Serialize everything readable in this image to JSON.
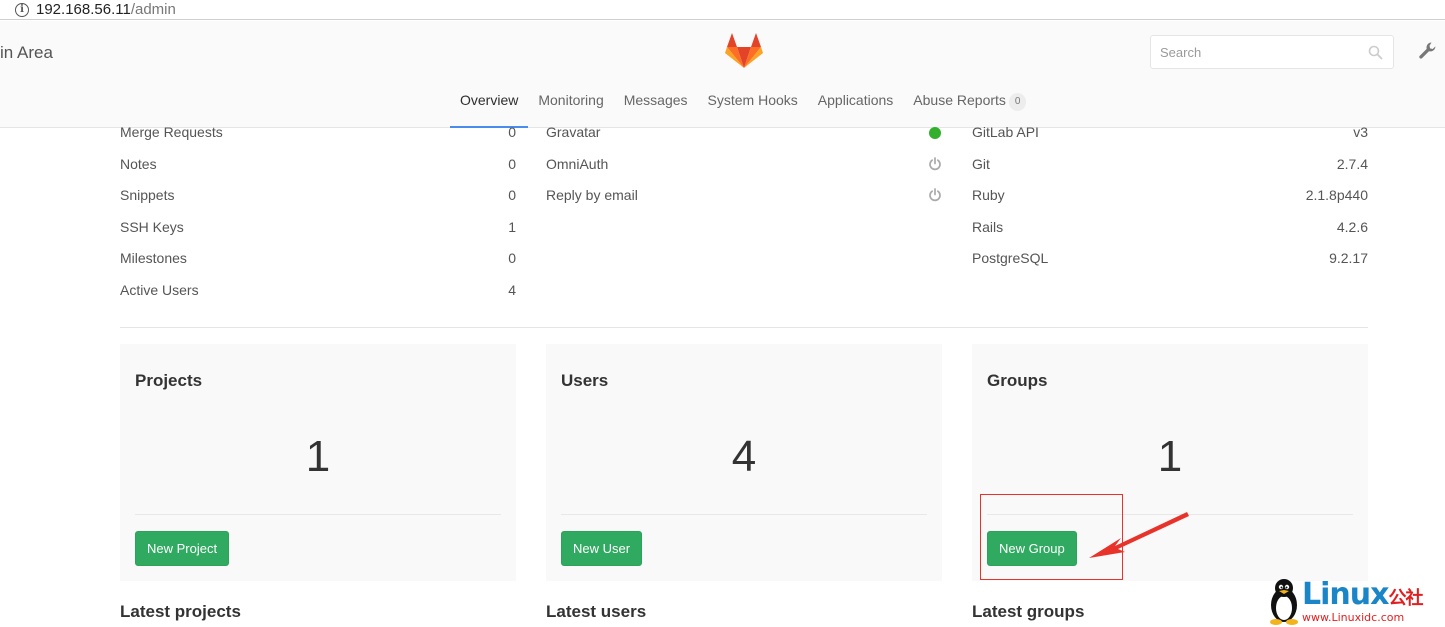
{
  "browser": {
    "url_host": "192.168.56.11",
    "url_path": "/admin"
  },
  "header": {
    "area_title": "in Area",
    "search_placeholder": "Search",
    "nav": [
      {
        "label": "Overview",
        "active": true
      },
      {
        "label": "Monitoring"
      },
      {
        "label": "Messages"
      },
      {
        "label": "System Hooks"
      },
      {
        "label": "Applications"
      },
      {
        "label": "Abuse Reports",
        "badge": "0"
      }
    ]
  },
  "stats": {
    "counts": [
      {
        "label": "Merge Requests",
        "value": "0"
      },
      {
        "label": "Notes",
        "value": "0"
      },
      {
        "label": "Snippets",
        "value": "0"
      },
      {
        "label": "SSH Keys",
        "value": "1"
      },
      {
        "label": "Milestones",
        "value": "0"
      },
      {
        "label": "Active Users",
        "value": "4"
      }
    ],
    "features": [
      {
        "label": "Gravatar",
        "status": "on"
      },
      {
        "label": "OmniAuth",
        "status": "off"
      },
      {
        "label": "Reply by email",
        "status": "off"
      }
    ],
    "components": [
      {
        "label": "GitLab API",
        "value": "v3"
      },
      {
        "label": "Git",
        "value": "2.7.4"
      },
      {
        "label": "Ruby",
        "value": "2.1.8p440"
      },
      {
        "label": "Rails",
        "value": "4.2.6"
      },
      {
        "label": "PostgreSQL",
        "value": "9.2.17"
      }
    ]
  },
  "cards": [
    {
      "title": "Projects",
      "count": "1",
      "button": "New Project"
    },
    {
      "title": "Users",
      "count": "4",
      "button": "New User"
    },
    {
      "title": "Groups",
      "count": "1",
      "button": "New Group"
    }
  ],
  "latest": {
    "projects": "Latest projects",
    "users": "Latest users",
    "groups": "Latest groups"
  },
  "watermark": {
    "brand": "Linux",
    "brand_suffix": "公社",
    "site": "www.Linuxidc.com"
  },
  "colors": {
    "accent": "#4a8bee",
    "button_green": "#2faa60",
    "status_on": "#31af2d",
    "annotation_red": "#e8332b"
  },
  "icons": {
    "info": "info-circle-icon",
    "logo": "gitlab-fox-icon",
    "search": "magnifier-icon",
    "admin": "wrench-icon",
    "feature_off": "power-icon"
  }
}
